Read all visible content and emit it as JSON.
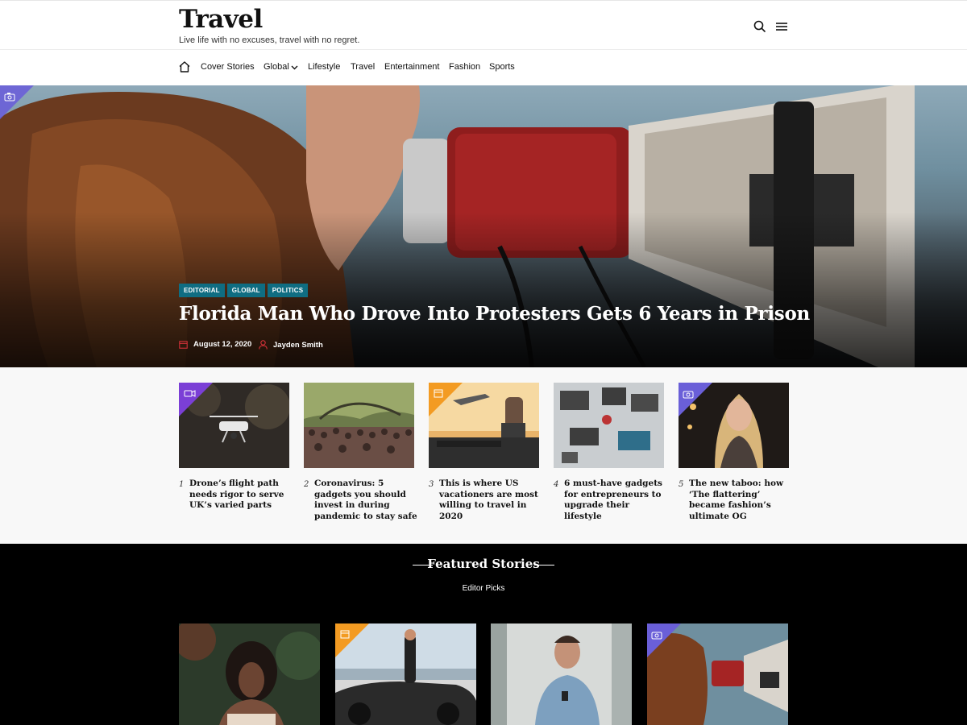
{
  "header": {
    "site_title": "Travel",
    "tagline": "Live life with no excuses, travel with no regret.",
    "icons": [
      "search-icon",
      "hamburger-menu-icon"
    ]
  },
  "nav": {
    "home_icon": "home-icon",
    "items": [
      {
        "label": "Cover Stories"
      },
      {
        "label": "Global",
        "has_dropdown": true
      },
      {
        "label": "Lifestyle"
      },
      {
        "label": "Travel"
      },
      {
        "label": "Entertainment"
      },
      {
        "label": "Fashion"
      },
      {
        "label": "Sports"
      }
    ]
  },
  "hero": {
    "format_icon": "camera-icon",
    "categories": [
      "EDITORIAL",
      "GLOBAL",
      "POLITICS"
    ],
    "title": "Florida Man Who Drove Into Protesters Gets 6 Years in Prison",
    "date": "August 12, 2020",
    "author": "Jayden Smith"
  },
  "trending": [
    {
      "num": "1",
      "title": "Drone’s flight path needs rigor to serve UK’s varied parts",
      "format_icon": "video-icon"
    },
    {
      "num": "2",
      "title": "Coronavirus: 5 gadgets you should invest in during pandemic to stay safe",
      "format_icon": ""
    },
    {
      "num": "3",
      "title": "This is where US vacationers are most willing to travel in 2020",
      "format_icon": "calendar-icon"
    },
    {
      "num": "4",
      "title": "6 must-have gadgets for entrepreneurs to upgrade their lifestyle",
      "format_icon": ""
    },
    {
      "num": "5",
      "title": "The new taboo: how ‘The flattering’ became fashion’s ultimate OG",
      "format_icon": "camera-icon"
    }
  ],
  "featured": {
    "heading": "Featured Stories",
    "subheading": "Editor Picks",
    "cards": [
      {
        "format_icon": ""
      },
      {
        "format_icon": "calendar-icon"
      },
      {
        "format_icon": ""
      },
      {
        "format_icon": "camera-icon"
      }
    ]
  },
  "colors": {
    "category_badge": "#0f6d82",
    "format_purple": "#7b3fd6",
    "format_orange": "#f39b22",
    "format_violet": "#6a5fd8",
    "meta_icon_red": "#e0333c"
  }
}
